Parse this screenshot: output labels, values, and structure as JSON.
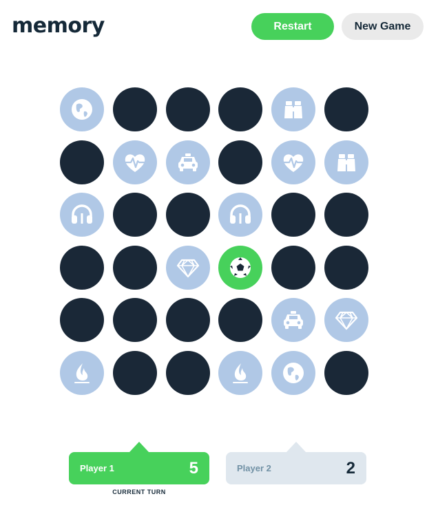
{
  "header": {
    "logo": "memory",
    "restart_label": "Restart",
    "new_game_label": "New Game"
  },
  "board": {
    "rows": [
      [
        {
          "state": "revealed",
          "icon": "globe"
        },
        {
          "state": "hidden",
          "icon": ""
        },
        {
          "state": "hidden",
          "icon": ""
        },
        {
          "state": "hidden",
          "icon": ""
        },
        {
          "state": "revealed",
          "icon": "binoculars"
        },
        {
          "state": "hidden",
          "icon": ""
        }
      ],
      [
        {
          "state": "hidden",
          "icon": ""
        },
        {
          "state": "revealed",
          "icon": "heartbeat"
        },
        {
          "state": "revealed",
          "icon": "taxi"
        },
        {
          "state": "hidden",
          "icon": ""
        },
        {
          "state": "revealed",
          "icon": "heartbeat"
        },
        {
          "state": "revealed",
          "icon": "binoculars"
        }
      ],
      [
        {
          "state": "revealed",
          "icon": "headphones"
        },
        {
          "state": "hidden",
          "icon": ""
        },
        {
          "state": "hidden",
          "icon": ""
        },
        {
          "state": "revealed",
          "icon": "headphones"
        },
        {
          "state": "hidden",
          "icon": ""
        },
        {
          "state": "hidden",
          "icon": ""
        }
      ],
      [
        {
          "state": "hidden",
          "icon": ""
        },
        {
          "state": "hidden",
          "icon": ""
        },
        {
          "state": "revealed",
          "icon": "gem"
        },
        {
          "state": "selected",
          "icon": "soccer-ball"
        },
        {
          "state": "hidden",
          "icon": ""
        },
        {
          "state": "hidden",
          "icon": ""
        }
      ],
      [
        {
          "state": "hidden",
          "icon": ""
        },
        {
          "state": "hidden",
          "icon": ""
        },
        {
          "state": "hidden",
          "icon": ""
        },
        {
          "state": "hidden",
          "icon": ""
        },
        {
          "state": "revealed",
          "icon": "taxi"
        },
        {
          "state": "revealed",
          "icon": "gem"
        }
      ],
      [
        {
          "state": "revealed",
          "icon": "fire"
        },
        {
          "state": "hidden",
          "icon": ""
        },
        {
          "state": "hidden",
          "icon": ""
        },
        {
          "state": "revealed",
          "icon": "fire"
        },
        {
          "state": "revealed",
          "icon": "globe"
        },
        {
          "state": "hidden",
          "icon": ""
        }
      ]
    ]
  },
  "players": [
    {
      "name": "Player 1",
      "score": "5",
      "active": true
    },
    {
      "name": "Player 2",
      "score": "2",
      "active": false
    }
  ],
  "current_turn_label": "CURRENT TURN",
  "colors": {
    "hidden": "#1a2837",
    "revealed": "#b0c8e6",
    "selected": "#47d15b",
    "active_player": "#47d15b",
    "inactive_player": "#dfe7ee"
  }
}
